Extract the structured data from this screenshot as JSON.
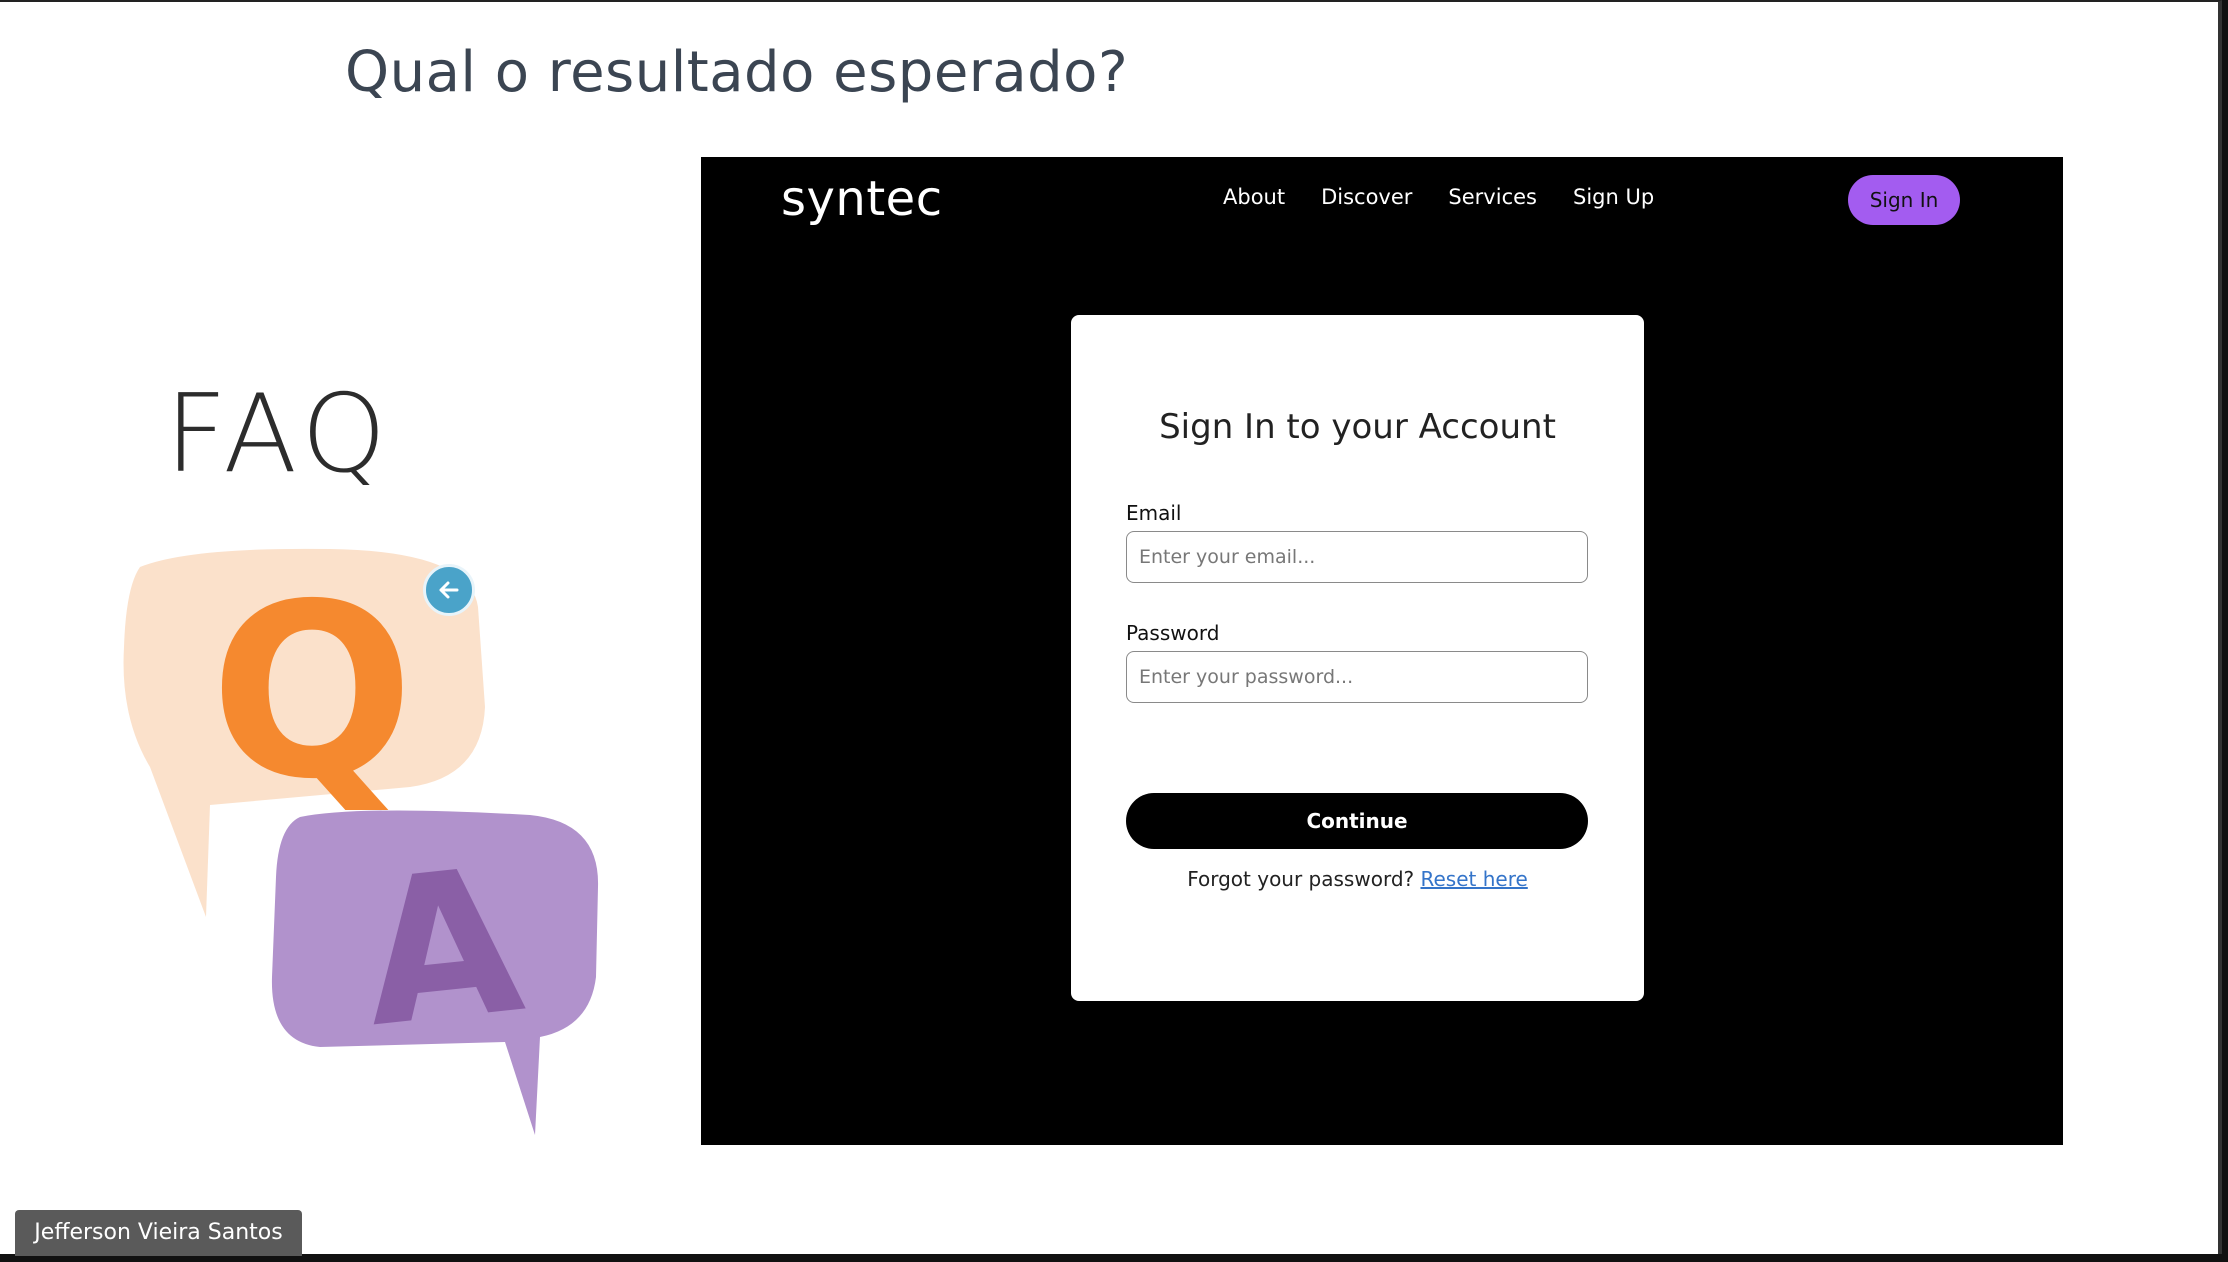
{
  "slide": {
    "title": "Qual o resultado esperado?",
    "faq_label": "FAQ",
    "qa_art": {
      "q_letter": "Q",
      "a_letter": "A",
      "q_color": "#f5892f",
      "a_color": "#8a5fa6"
    }
  },
  "website": {
    "logo": "syntec",
    "nav": [
      "About",
      "Discover",
      "Services",
      "Sign Up"
    ],
    "signin_button": "Sign In",
    "accent_color": "#a35cf0",
    "card": {
      "title": "Sign In to your Account",
      "email_label": "Email",
      "email_placeholder": "Enter your email...",
      "password_label": "Password",
      "password_placeholder": "Enter your password...",
      "continue_label": "Continue",
      "forgot_text": "Forgot your password?",
      "reset_link": "Reset here"
    }
  },
  "participant": {
    "name": "Jefferson Vieira Santos"
  }
}
